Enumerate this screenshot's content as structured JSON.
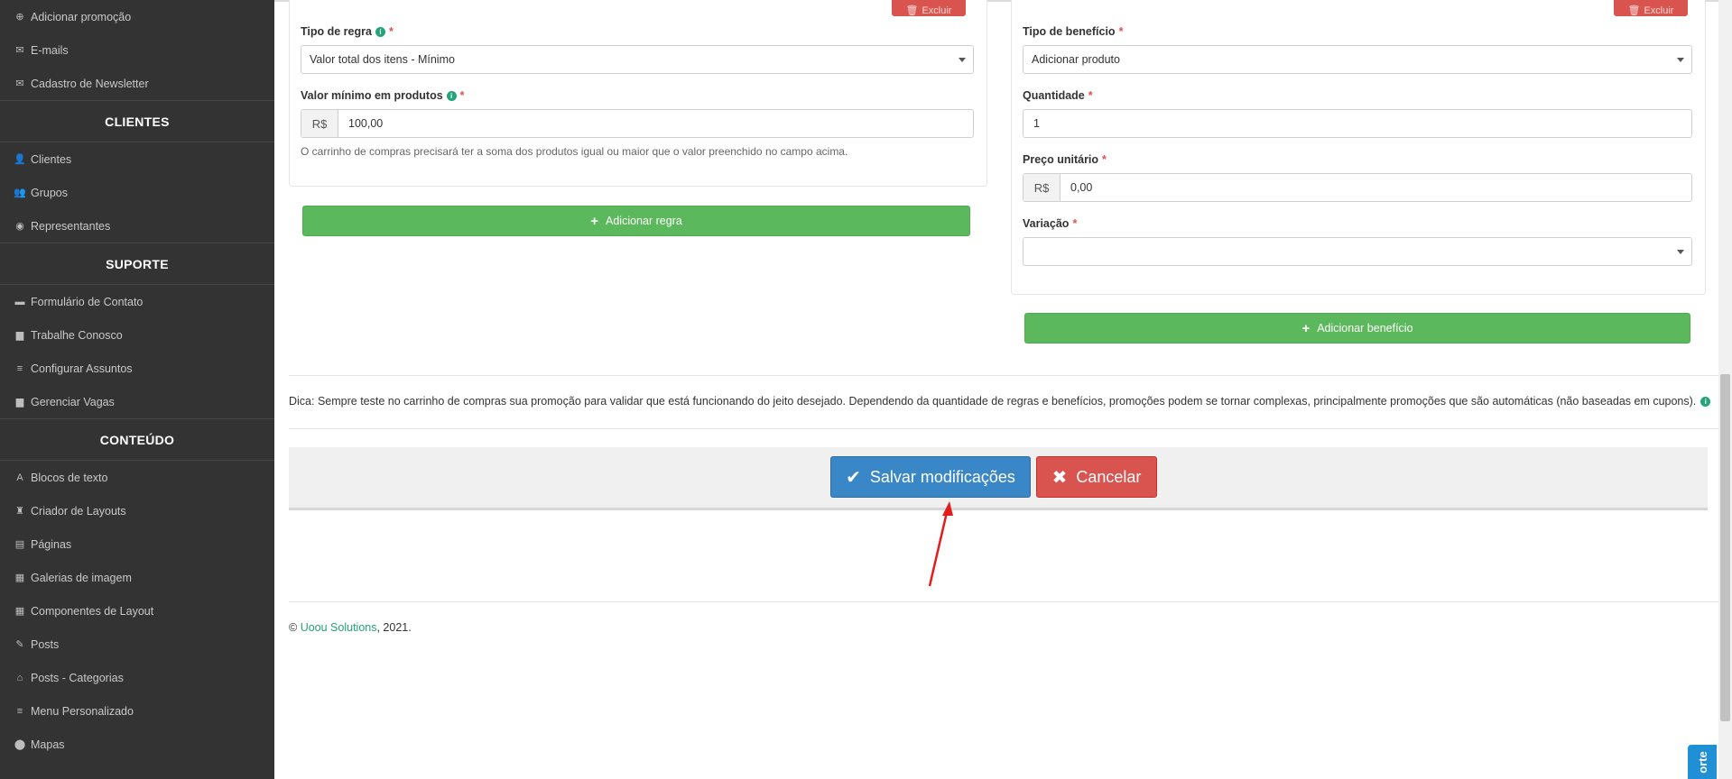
{
  "sidebar": {
    "group1": [
      {
        "label": "Adicionar promoção",
        "icon": "plus-circle-icon",
        "glyph": "⊕"
      },
      {
        "label": "E-mails",
        "icon": "envelope-icon",
        "glyph": "✉"
      },
      {
        "label": "Cadastro de Newsletter",
        "icon": "envelope-icon",
        "glyph": "✉"
      }
    ],
    "heading_clientes": "CLIENTES",
    "clientes": [
      {
        "label": "Clientes",
        "icon": "user-icon",
        "glyph": "👤"
      },
      {
        "label": "Grupos",
        "icon": "users-icon",
        "glyph": "👥"
      },
      {
        "label": "Representantes",
        "icon": "user-circle-icon",
        "glyph": "◉"
      }
    ],
    "heading_suporte": "SUPORTE",
    "suporte": [
      {
        "label": "Formulário de Contato",
        "icon": "comment-icon",
        "glyph": "▬"
      },
      {
        "label": "Trabalhe Conosco",
        "icon": "briefcase-icon",
        "glyph": "▆"
      },
      {
        "label": "Configurar Assuntos",
        "icon": "list-icon",
        "glyph": "≡"
      },
      {
        "label": "Gerenciar Vagas",
        "icon": "briefcase-icon",
        "glyph": "▆"
      }
    ],
    "heading_conteudo": "CONTEÚDO",
    "conteudo": [
      {
        "label": "Blocos de texto",
        "icon": "font-icon",
        "glyph": "A"
      },
      {
        "label": "Criador de Layouts",
        "icon": "chess-icon",
        "glyph": "♜"
      },
      {
        "label": "Páginas",
        "icon": "file-icon",
        "glyph": "▤"
      },
      {
        "label": "Galerias de imagem",
        "icon": "film-icon",
        "glyph": "▦"
      },
      {
        "label": "Componentes de Layout",
        "icon": "th-large-icon",
        "glyph": "▦"
      },
      {
        "label": "Posts",
        "icon": "pin-icon",
        "glyph": "✎"
      },
      {
        "label": "Posts - Categorias",
        "icon": "home-icon",
        "glyph": "⌂"
      },
      {
        "label": "Menu Personalizado",
        "icon": "list-icon",
        "glyph": "≡"
      },
      {
        "label": "Mapas",
        "icon": "map-marker-icon",
        "glyph": "⬤"
      }
    ]
  },
  "rule": {
    "delete_label": "Excluir",
    "type_label": "Tipo de regra",
    "type_value": "Valor total dos itens - Mínimo",
    "min_label": "Valor mínimo em produtos",
    "currency": "R$",
    "min_value": "100,00",
    "help": "O carrinho de compras precisará ter a soma dos produtos igual ou maior que o valor preenchido no campo acima.",
    "add_label": "Adicionar regra"
  },
  "benefit": {
    "delete_label": "Excluir",
    "type_label": "Tipo de benefício",
    "type_value": "Adicionar produto",
    "qty_label": "Quantidade",
    "qty_value": "1",
    "price_label": "Preço unitário",
    "currency": "R$",
    "price_value": "0,00",
    "variation_label": "Variação",
    "variation_value": "",
    "add_label": "Adicionar benefício"
  },
  "tip": "Dica: Sempre teste no carrinho de compras sua promoção para validar que está funcionando do jeito desejado. Dependendo da quantidade de regras e benefícios, promoções podem se tornar complexas, principalmente promoções que são automáticas (não baseadas em cupons).",
  "actions": {
    "save_label": "Salvar modificações",
    "cancel_label": "Cancelar"
  },
  "footer": {
    "copy": "©",
    "company": "Uoou Solutions",
    "year": ", 2021."
  },
  "support_tab": "orte",
  "colors": {
    "sidebar_bg": "#333333",
    "green": "#5cb85c",
    "blue": "#3a87c8",
    "red": "#d9534f",
    "link": "#25a37a",
    "annotation_arrow": "#e31c1c"
  }
}
